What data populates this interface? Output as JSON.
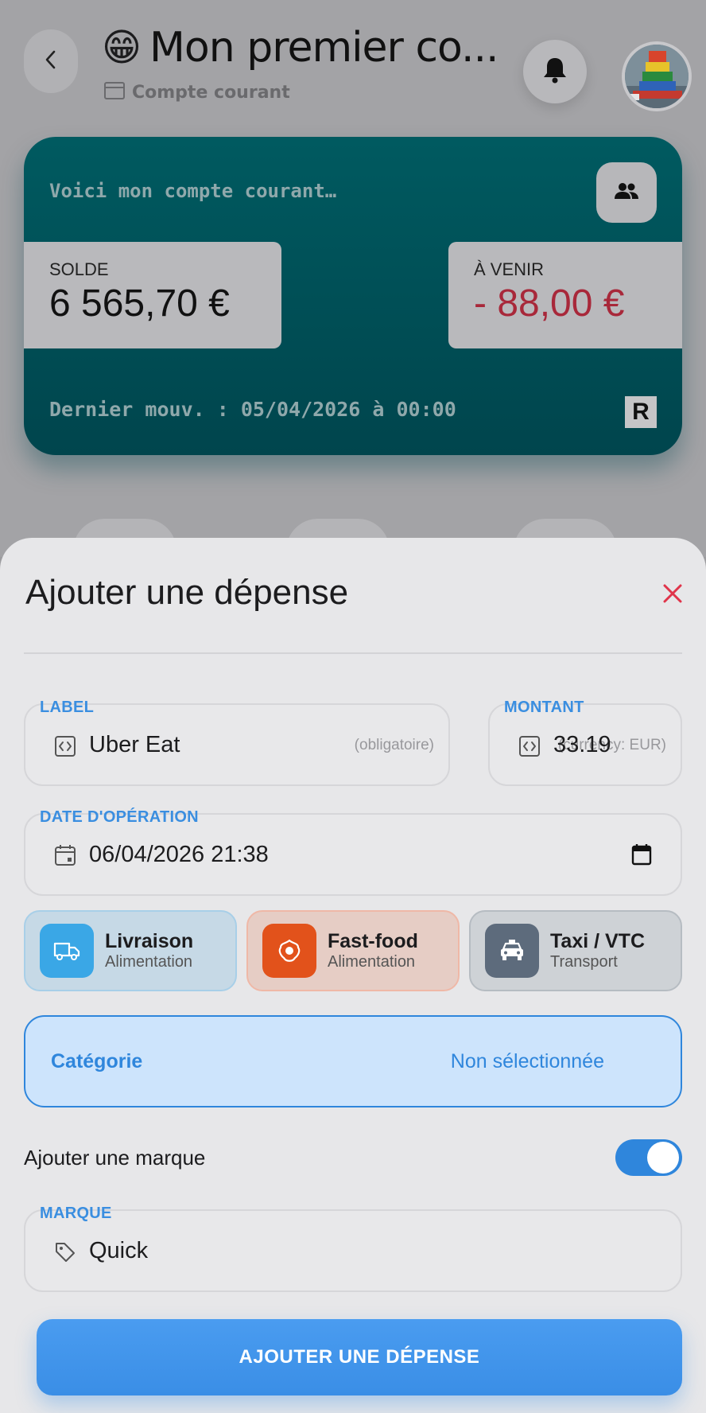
{
  "header": {
    "title_emoji": "😁",
    "title": "Mon premier co...",
    "subtitle": "Compte courant"
  },
  "account_card": {
    "description": "Voici mon compte courant…",
    "balance_label": "SOLDE",
    "balance_value": "6 565,70 €",
    "upcoming_label": "À VENIR",
    "upcoming_value": "- 88,00 €",
    "last_movement": "Dernier mouv. : 05/04/2026 à 00:00",
    "bank_logo_letter": "R"
  },
  "sheet": {
    "title": "Ajouter une dépense",
    "label_field": {
      "label": "LABEL",
      "value": "Uber Eat",
      "hint": "(obligatoire)"
    },
    "amount_field": {
      "label": "MONTANT",
      "value": "33.19",
      "hint": "(currency: EUR)"
    },
    "date_field": {
      "label": "DATE D'OPÉRATION",
      "value": "06/04/2026 21:38"
    },
    "suggestions": [
      {
        "name": "Livraison",
        "group": "Alimentation",
        "icon": "truck-icon",
        "bg": "#c6d9e6",
        "border": "#a8cfe8",
        "icon_bg": "#3aa7e6"
      },
      {
        "name": "Fast-food",
        "group": "Alimentation",
        "icon": "burger-icon",
        "bg": "#e6cdc5",
        "border": "#efb8a7",
        "icon_bg": "#e2521b"
      },
      {
        "name": "Taxi / VTC",
        "group": "Transport",
        "icon": "taxi-icon",
        "bg": "#ced2d6",
        "border": "#b6bcc2",
        "icon_bg": "#5d6b7c"
      }
    ],
    "category": {
      "label": "Catégorie",
      "value": "Non sélectionnée"
    },
    "brand_toggle": {
      "label": "Ajouter une marque",
      "on": true
    },
    "brand_field": {
      "label": "MARQUE",
      "value": "Quick"
    },
    "submit_label": "AJOUTER UNE DÉPENSE"
  },
  "colors": {
    "accent": "#3a8ee6",
    "card": "#00535a",
    "negative": "#a8283a",
    "close": "#e0344a"
  }
}
